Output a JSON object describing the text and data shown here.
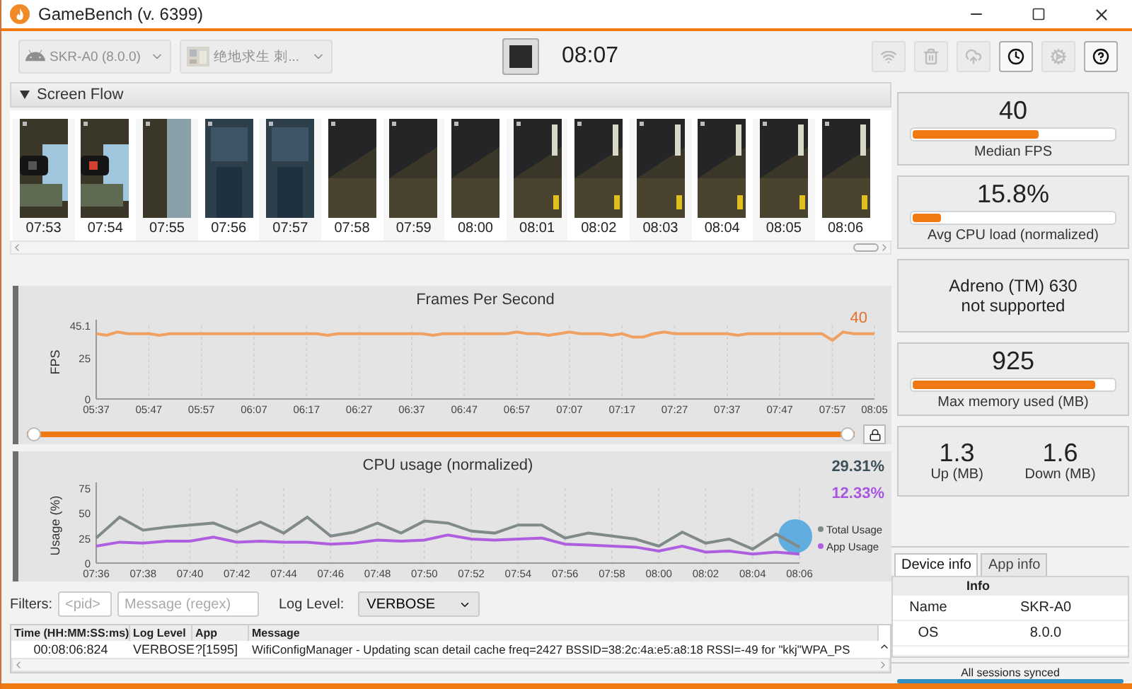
{
  "window": {
    "title": "GameBench (v. 6399)"
  },
  "toolbar": {
    "device_selector": {
      "value": "SKR-A0 (8.0.0)",
      "disabled": true
    },
    "app_selector": {
      "value": "绝地求生 刺...",
      "disabled": true
    },
    "timer": "08:07",
    "icon_buttons": [
      {
        "kind": "wifi",
        "disabled": true
      },
      {
        "kind": "trash",
        "disabled": true
      },
      {
        "kind": "upload",
        "disabled": true
      },
      {
        "kind": "clock",
        "disabled": false
      },
      {
        "kind": "gears",
        "disabled": true
      },
      {
        "kind": "help",
        "disabled": false
      }
    ]
  },
  "screen_flow": {
    "title": "Screen Flow",
    "expanded": true,
    "frames": [
      {
        "time": "07:53"
      },
      {
        "time": "07:54"
      },
      {
        "time": "07:55"
      },
      {
        "time": "07:56"
      },
      {
        "time": "07:57"
      },
      {
        "time": "07:58"
      },
      {
        "time": "07:59"
      },
      {
        "time": "08:00"
      },
      {
        "time": "08:01"
      },
      {
        "time": "08:02"
      },
      {
        "time": "08:03"
      },
      {
        "time": "08:04"
      },
      {
        "time": "08:05"
      },
      {
        "time": "08:06"
      }
    ]
  },
  "fps_panel": {
    "reading": "40",
    "time_range": {
      "level": 1
    },
    "chart_data": {
      "type": "line",
      "title": "Frames Per Second",
      "ylabel": "FPS",
      "categories": [
        "05:37",
        null,
        null,
        null,
        null,
        "05:47",
        null,
        null,
        null,
        null,
        "05:57",
        null,
        null,
        null,
        null,
        "06:07",
        null,
        null,
        null,
        null,
        "06:17",
        null,
        null,
        null,
        null,
        "06:27",
        null,
        null,
        null,
        null,
        "06:37",
        null,
        null,
        null,
        null,
        "06:47",
        null,
        null,
        null,
        null,
        "06:57",
        null,
        null,
        null,
        null,
        "07:07",
        null,
        null,
        null,
        null,
        "07:17",
        null,
        null,
        null,
        null,
        "07:27",
        null,
        null,
        null,
        null,
        "07:37",
        null,
        null,
        null,
        null,
        "07:47",
        null,
        null,
        null,
        null,
        "07:57",
        null,
        null,
        null,
        "08:05"
      ],
      "series": [
        {
          "color": "#f0a060",
          "values": [
            40,
            39,
            41,
            40,
            40,
            40,
            39,
            40,
            40,
            40,
            40,
            40,
            40,
            40,
            40,
            40,
            40,
            40,
            40,
            40,
            40,
            40,
            39,
            40,
            40,
            40,
            40,
            40,
            40,
            40,
            40,
            40,
            39,
            40,
            40,
            40,
            40,
            40,
            40,
            40,
            41,
            40,
            40,
            39,
            40,
            41,
            40,
            40,
            40,
            39,
            40,
            38,
            38,
            40,
            41,
            40,
            40,
            40,
            40,
            40,
            40,
            39,
            40,
            40,
            40,
            40,
            40,
            40,
            40,
            40,
            36,
            41,
            40,
            40,
            40
          ]
        }
      ],
      "ylim": [
        0,
        45.1
      ],
      "yticks": [
        0,
        25,
        45.1
      ],
      "grid": true
    }
  },
  "cpu_panel": {
    "readings": [
      {
        "text": "29.31%",
        "color": "#3d4f58"
      },
      {
        "text": "12.33%",
        "color": "#a855e0"
      }
    ],
    "chart_data": {
      "type": "line",
      "title": "CPU usage (normalized)",
      "ylabel": "Usage (%)",
      "categories": [
        "07:36",
        null,
        "07:38",
        null,
        "07:40",
        null,
        "07:42",
        null,
        "07:44",
        null,
        "07:46",
        null,
        "07:48",
        null,
        "07:50",
        null,
        "07:52",
        null,
        "07:54",
        null,
        "07:56",
        null,
        "07:58",
        null,
        "08:00",
        null,
        "08:02",
        null,
        "08:04",
        null,
        "08:06"
      ],
      "series": [
        {
          "name": "Total Usage",
          "color": "#808a8a",
          "values": [
            25,
            46,
            33,
            36,
            38,
            40,
            31,
            41,
            30,
            46,
            27,
            31,
            40,
            30,
            42,
            40,
            32,
            30,
            38,
            38,
            25,
            30,
            27,
            24,
            17,
            31,
            20,
            24,
            14,
            29,
            16
          ]
        },
        {
          "name": "App Usage",
          "color": "#b05ee0",
          "values": [
            17,
            21,
            20,
            22,
            22,
            26,
            21,
            22,
            21,
            21,
            19,
            20,
            23,
            22,
            23,
            28,
            24,
            23,
            24,
            25,
            19,
            18,
            17,
            16,
            12,
            17,
            11,
            12,
            9,
            11,
            9
          ]
        }
      ],
      "ylim": [
        0,
        75
      ],
      "yticks": [
        0,
        25,
        50,
        75
      ],
      "grid": true,
      "legend": "right"
    }
  },
  "filters": {
    "label": "Filters:",
    "pid_field": {
      "placeholder": "<pid>"
    },
    "message_field": {
      "placeholder": "Message (regex)"
    },
    "log_level_label": "Log Level:",
    "log_level": "VERBOSE"
  },
  "log_table": {
    "columns": [
      "Time (HH:MM:SS:ms)",
      "Log Level",
      "App",
      "Message"
    ],
    "rows": [
      [
        "00:08:06:824",
        "VERBOSE",
        "?[1595]",
        "WifiConfigManager - Updating scan detail cache freq=2427 BSSID=38:2c:4a:e5:a8:18 RSSI=-49 for \"kkj\"WPA_PS"
      ]
    ]
  },
  "metrics": [
    {
      "kind": "bar",
      "value": "40",
      "label": "Median FPS",
      "level": 0.63
    },
    {
      "kind": "bar",
      "value": "15.8%",
      "label": "Avg CPU load (normalized)",
      "level": 0.14
    },
    {
      "kind": "text",
      "lines": [
        "Adreno (TM) 630",
        "not supported"
      ]
    },
    {
      "kind": "bar",
      "value": "925",
      "label": "Max memory used (MB)",
      "level": 0.91
    },
    {
      "kind": "pair",
      "items": [
        {
          "value": "1.3",
          "label": "Up (MB)"
        },
        {
          "value": "1.6",
          "label": "Down (MB)"
        }
      ]
    }
  ],
  "info_panel": {
    "tabs": [
      {
        "label": "Device info",
        "selected": true
      },
      {
        "label": "App info",
        "selected": false
      }
    ],
    "header": "Info",
    "rows": [
      {
        "name": "Name",
        "value": "SKR-A0"
      },
      {
        "name": "OS",
        "value": "8.0.0"
      }
    ]
  },
  "status_bar": {
    "text": "All sessions synced",
    "level": 1
  }
}
